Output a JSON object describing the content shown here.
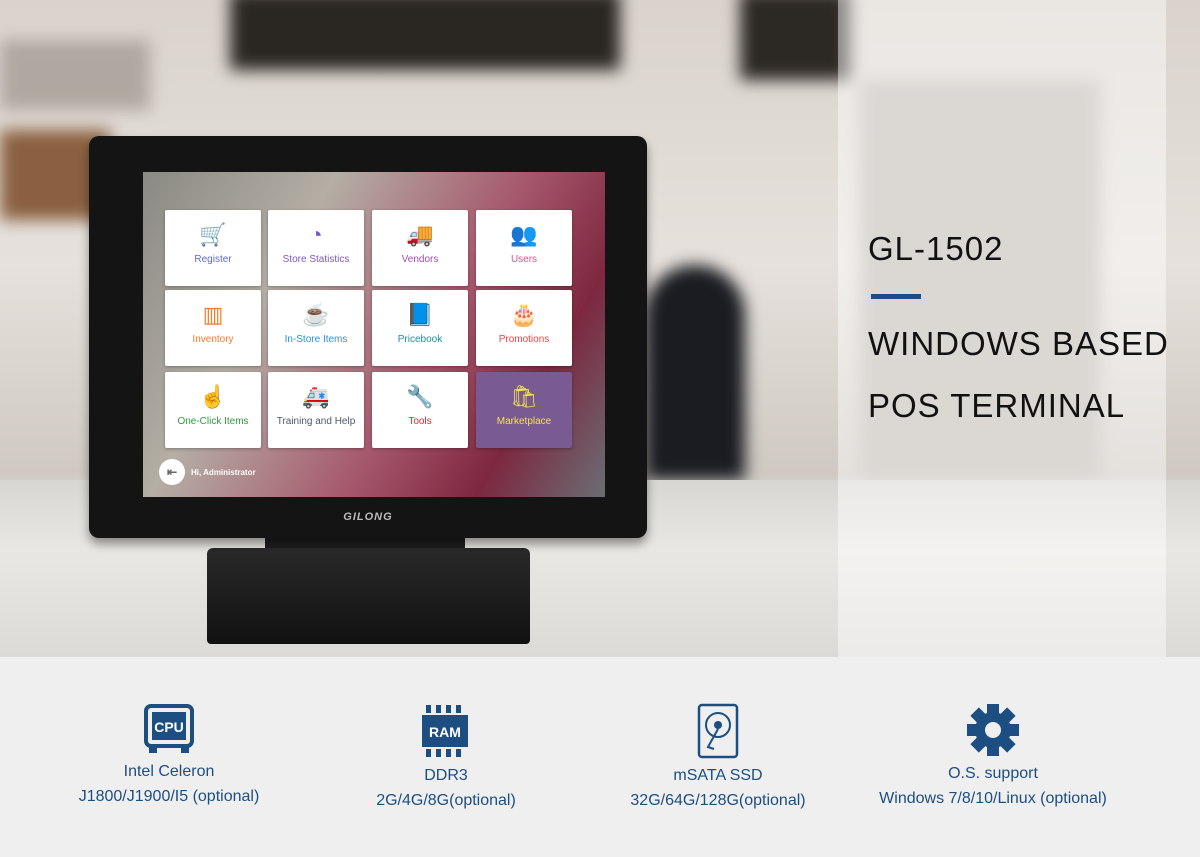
{
  "headline": {
    "model": "GL-1502",
    "line1": "WINDOWS BASED",
    "line2": "POS TERMINAL"
  },
  "brand": "GILONG",
  "screen": {
    "tiles": [
      {
        "label": "Register",
        "icon": "cart-icon",
        "glyph": "🛒",
        "color": "#5c6bc0"
      },
      {
        "label": "Store Statistics",
        "icon": "gauge-icon",
        "glyph": "◔",
        "color": "#7e57c2"
      },
      {
        "label": "Vendors",
        "icon": "truck-icon",
        "glyph": "🚚",
        "color": "#9c4fb0"
      },
      {
        "label": "Users",
        "icon": "users-icon",
        "glyph": "👥",
        "color": "#e84d8a"
      },
      {
        "label": "Inventory",
        "icon": "barcode-icon",
        "glyph": "▥",
        "color": "#f57c2a"
      },
      {
        "label": "In-Store Items",
        "icon": "coffee-cup-icon",
        "glyph": "☕",
        "color": "#2a8fd6"
      },
      {
        "label": "Pricebook",
        "icon": "book-icon",
        "glyph": "📘",
        "color": "#16939c"
      },
      {
        "label": "Promotions",
        "icon": "cake-icon",
        "glyph": "🎂",
        "color": "#e84545"
      },
      {
        "label": "One-Click Items",
        "icon": "pointer-hand-icon",
        "glyph": "☝",
        "color": "#2e9a3c"
      },
      {
        "label": "Training and Help",
        "icon": "ambulance-icon",
        "glyph": "🚑",
        "color": "#4a5a6a"
      },
      {
        "label": "Tools",
        "icon": "wrench-icon",
        "glyph": "🔧",
        "color": "#e02828"
      },
      {
        "label": "Marketplace",
        "icon": "shopping-bag-icon",
        "glyph": "🛍",
        "color": "#f5e050",
        "bg": "#7a5a92"
      }
    ],
    "greeting": "Hi, Administrator"
  },
  "specs": [
    {
      "icon": "cpu-icon",
      "title": "Intel Celeron",
      "detail": "J1800/J1900/I5 (optional)"
    },
    {
      "icon": "ram-icon",
      "title": "DDR3",
      "detail": "2G/4G/8G(optional)"
    },
    {
      "icon": "hard-drive-icon",
      "title": "mSATA SSD",
      "detail": "32G/64G/128G(optional)"
    },
    {
      "icon": "gear-icon",
      "title": "O.S. support",
      "detail": "Windows 7/8/10/Linux (optional)"
    }
  ],
  "colors": {
    "accent": "#1d4e82",
    "spec_bg": "#efefef"
  }
}
